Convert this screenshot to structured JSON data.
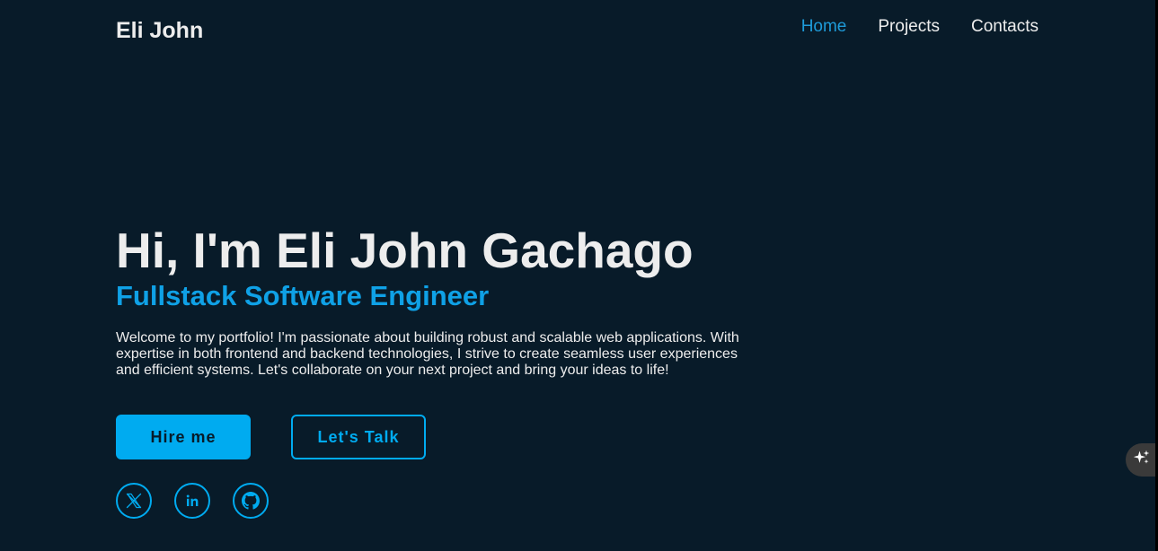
{
  "header": {
    "logo": "Eli John",
    "nav": [
      "Home",
      "Projects",
      "Contacts"
    ],
    "active_nav": "Home"
  },
  "hero": {
    "title": "Hi, I'm Eli John Gachago",
    "subtitle": "Fullstack Software Engineer",
    "description": "Welcome to my portfolio! I'm passionate about building robust and scalable web applications. With expertise in both frontend and backend technologies, I strive to create seamless user experiences and efficient systems. Let's collaborate on your next project and bring your ideas to life!",
    "buttons": {
      "hire": "Hire me",
      "talk": "Let's Talk"
    }
  },
  "social": [
    {
      "icon": "x-twitter-icon"
    },
    {
      "icon": "linkedin-icon"
    },
    {
      "icon": "github-icon"
    }
  ],
  "assistant": {
    "icon": "sparkle-icon"
  },
  "colors": {
    "background": "#081b29",
    "accent": "#00abf0",
    "text": "#ededed"
  }
}
